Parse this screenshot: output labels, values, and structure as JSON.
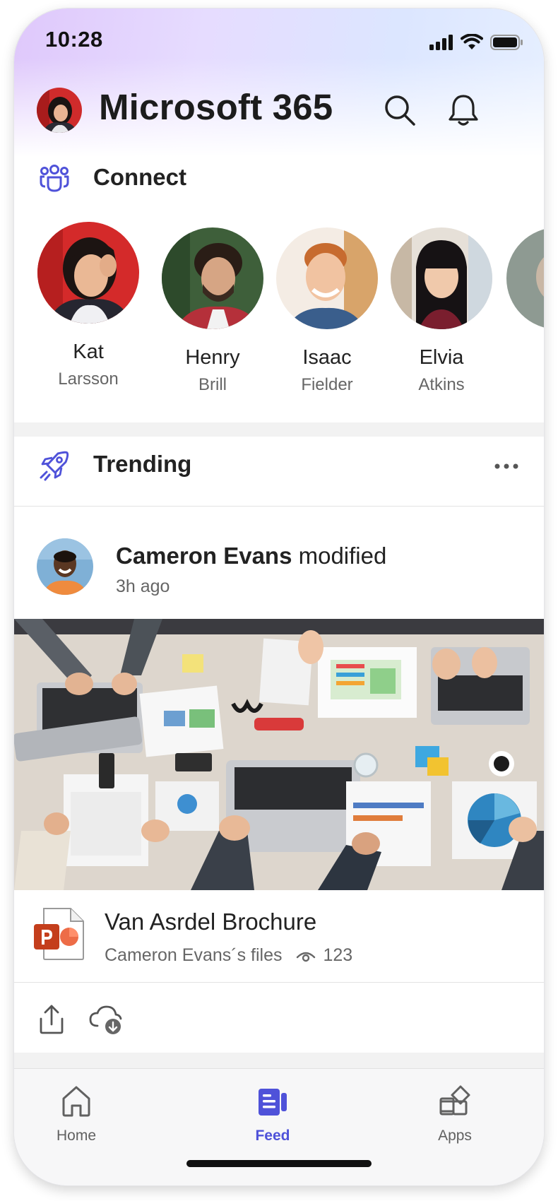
{
  "status": {
    "time": "10:28"
  },
  "header": {
    "title": "Microsoft 365"
  },
  "connect": {
    "title": "Connect",
    "people": [
      {
        "first": "Kat",
        "last": "Larsson"
      },
      {
        "first": "Henry",
        "last": "Brill"
      },
      {
        "first": "Isaac",
        "last": "Fielder"
      },
      {
        "first": "Elvia",
        "last": "Atkins"
      }
    ]
  },
  "trending": {
    "title": "Trending",
    "post": {
      "author": "Cameron Evans",
      "action": "modified",
      "time": "3h ago",
      "file": {
        "name": "Van Asrdel Brochure",
        "source": "Cameron Evans´s files",
        "views": "123"
      }
    }
  },
  "tabs": [
    {
      "label": "Home",
      "icon": "home-icon"
    },
    {
      "label": "Feed",
      "icon": "feed-icon",
      "active": true
    },
    {
      "label": "Apps",
      "icon": "apps-icon"
    }
  ],
  "colors": {
    "accent": "#4f52d9",
    "powerpoint": "#c43e1c"
  }
}
